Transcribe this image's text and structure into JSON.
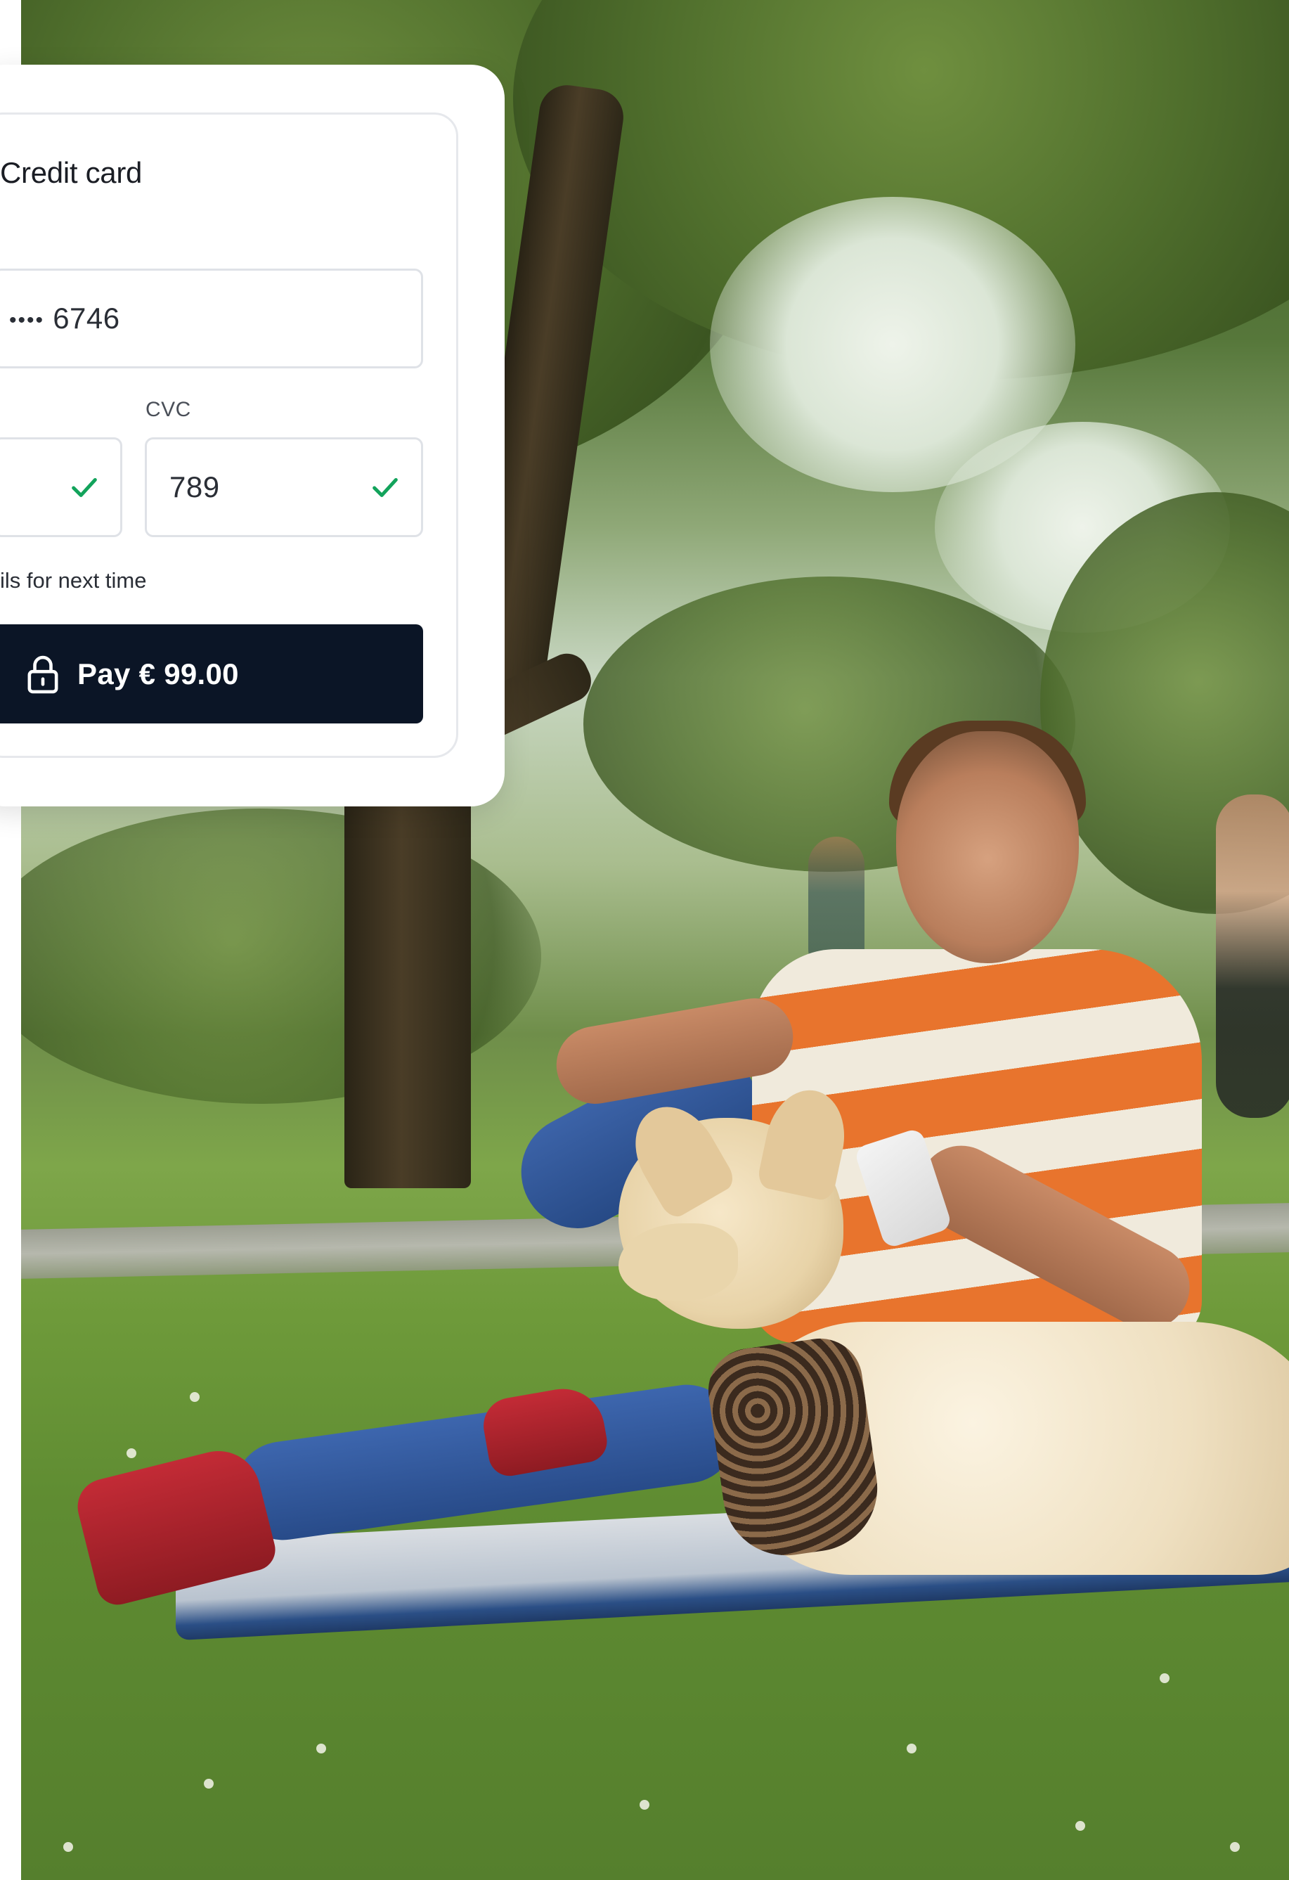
{
  "payment_form": {
    "section_title": "Credit card",
    "card_number": {
      "masked_dots": "••••",
      "last_digits": "6746"
    },
    "expiry": {
      "valid": true
    },
    "cvc": {
      "label": "CVC",
      "value": "789",
      "valid": true
    },
    "save_details_text": "ils for next time",
    "pay_button_label": "Pay € 99.00"
  },
  "icons": {
    "check": "check-icon",
    "lock": "lock-icon"
  },
  "colors": {
    "button_background": "#0b1526",
    "button_text": "#ffffff",
    "check_green": "#12a35b",
    "field_border": "#dfe2e7"
  }
}
